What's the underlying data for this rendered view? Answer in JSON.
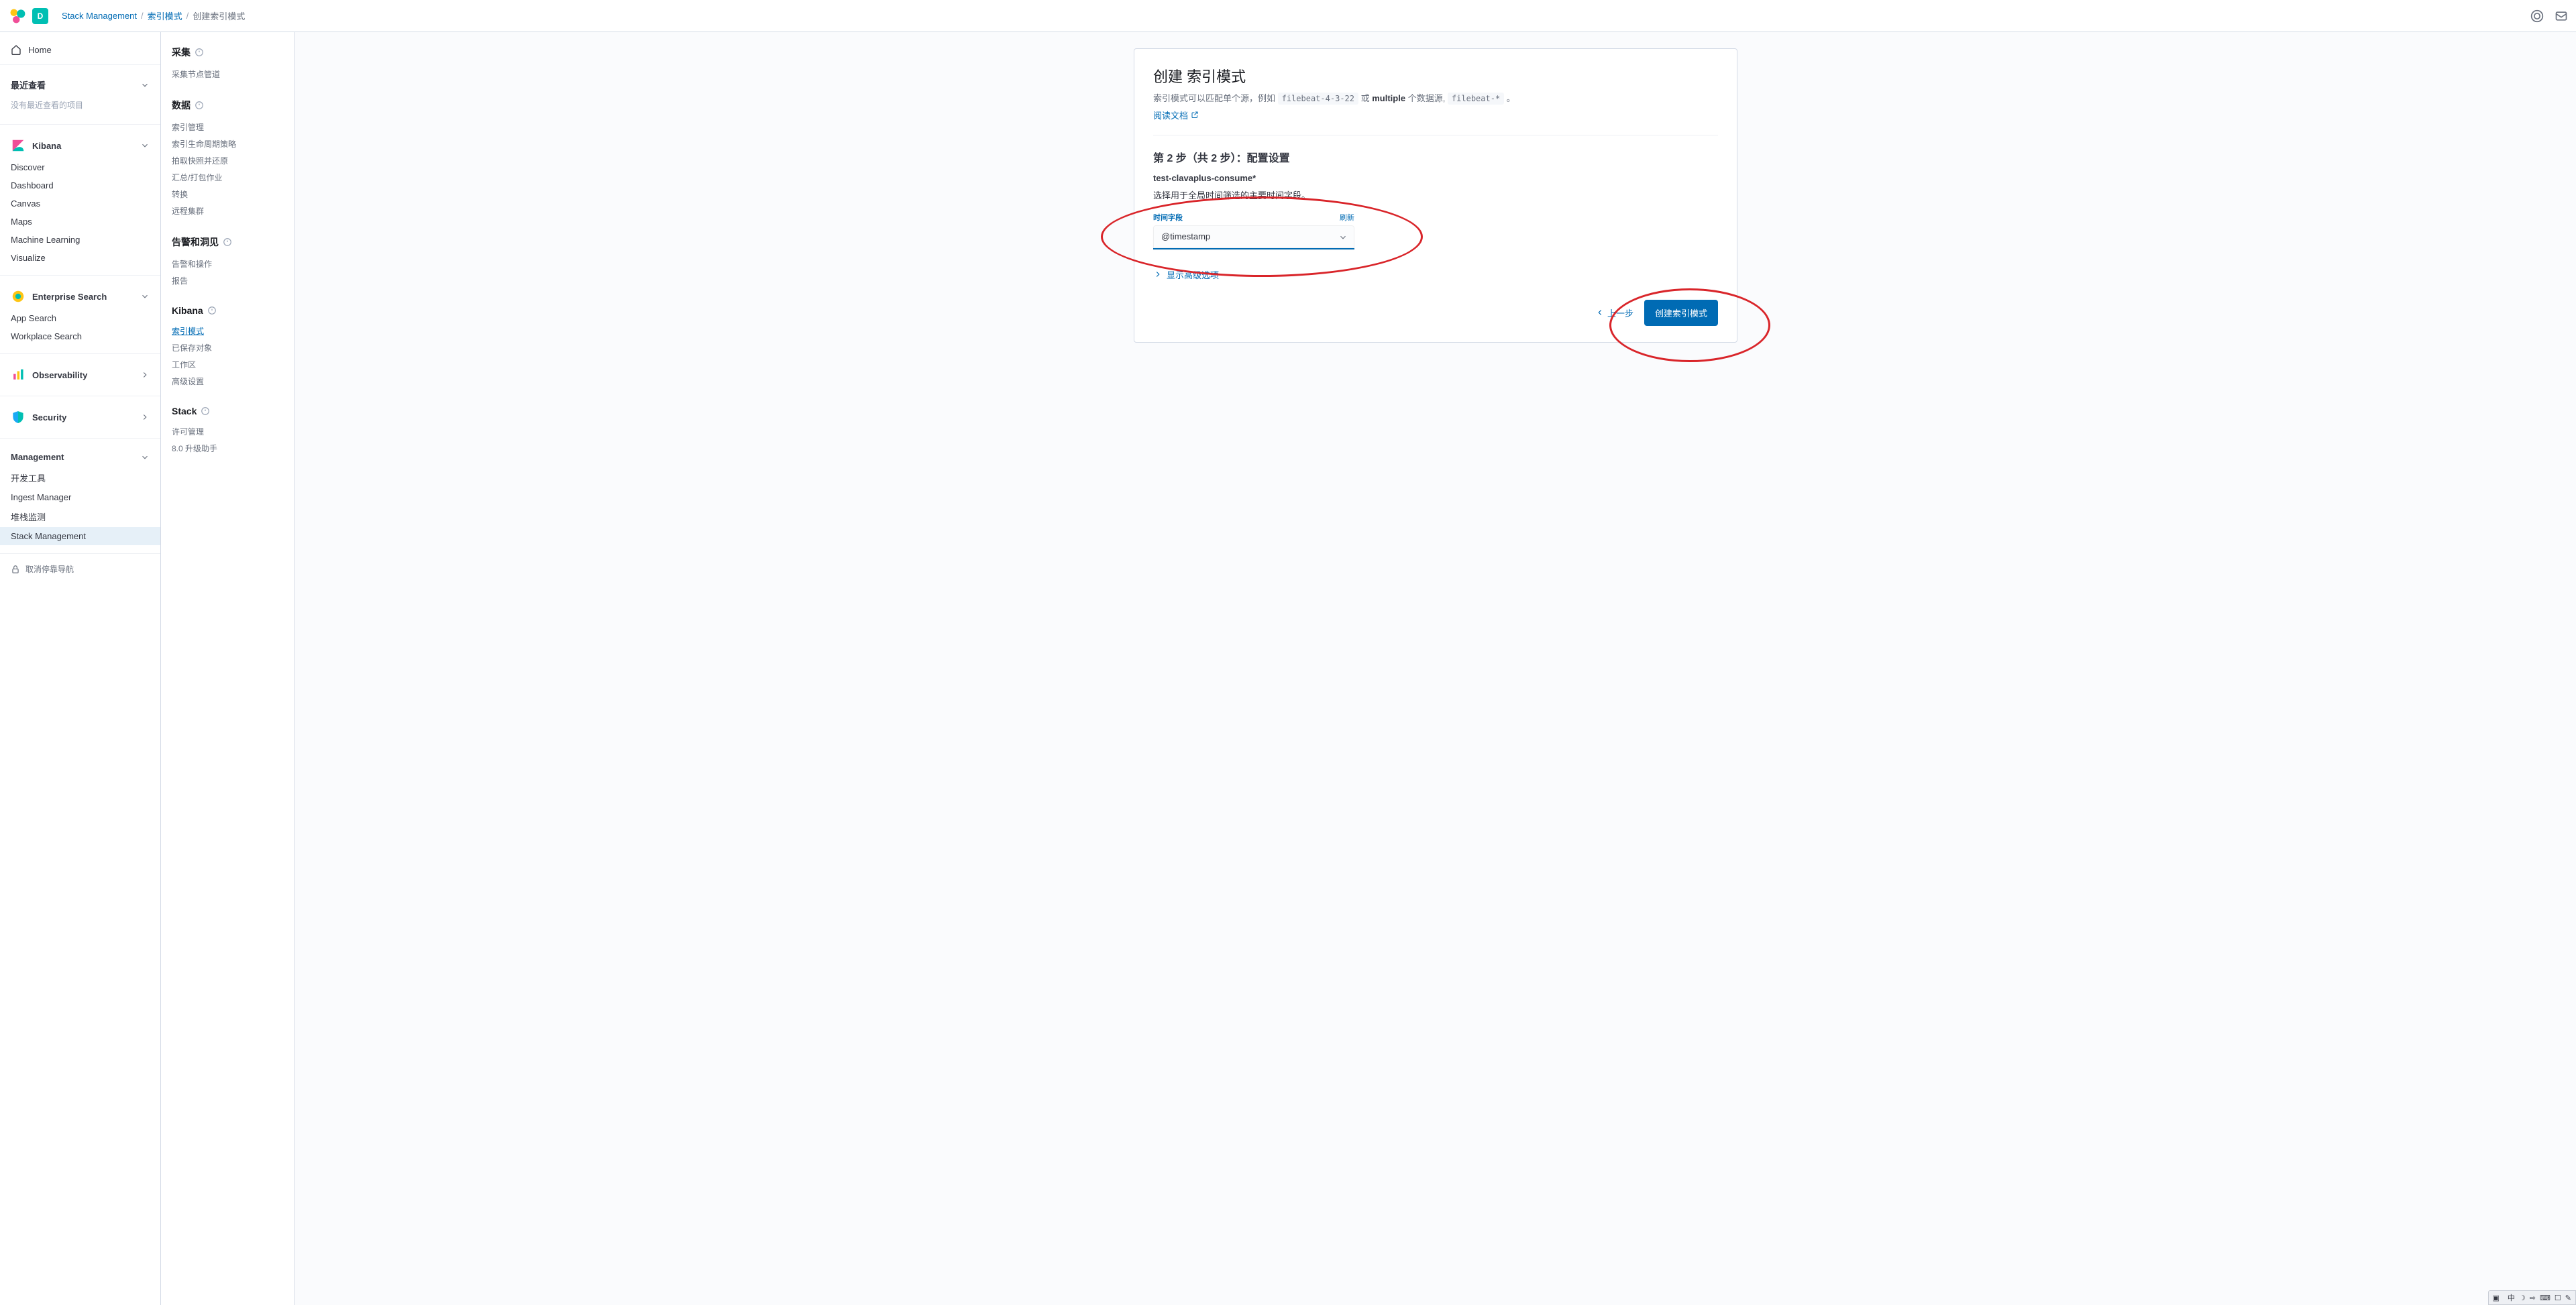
{
  "header": {
    "space_initial": "D",
    "breadcrumb": [
      "Stack Management",
      "索引模式",
      "创建索引模式"
    ]
  },
  "nav": {
    "home": "Home",
    "recent_title": "最近查看",
    "recent_empty": "没有最近查看的项目",
    "kibana_title": "Kibana",
    "kibana_items": [
      "Discover",
      "Dashboard",
      "Canvas",
      "Maps",
      "Machine Learning",
      "Visualize"
    ],
    "es_title": "Enterprise Search",
    "es_items": [
      "App Search",
      "Workplace Search"
    ],
    "obs_title": "Observability",
    "sec_title": "Security",
    "mgmt_title": "Management",
    "mgmt_items": [
      "开发工具",
      "Ingest Manager",
      "堆栈监测",
      "Stack Management"
    ],
    "mgmt_active_index": 3,
    "dock": "取消停靠导航"
  },
  "mgmt_nav": {
    "groups": [
      {
        "title": "采集",
        "items": [
          "采集节点管道"
        ]
      },
      {
        "title": "数据",
        "items": [
          "索引管理",
          "索引生命周期策略",
          "拍取快照并还原",
          "汇总/打包作业",
          "转换",
          "远程集群"
        ]
      },
      {
        "title": "告警和洞见",
        "items": [
          "告警和操作",
          "报告"
        ]
      },
      {
        "title": "Kibana",
        "items": [
          "索引模式",
          "已保存对象",
          "工作区",
          "高级设置"
        ],
        "active_index": 0
      },
      {
        "title": "Stack",
        "items": [
          "许可管理",
          "8.0 升级助手"
        ]
      }
    ]
  },
  "main": {
    "title": "创建 索引模式",
    "desc_pre": "索引模式可以匹配单个源，例如 ",
    "desc_code1": "filebeat-4-3-22",
    "desc_mid": " 或 ",
    "desc_bold": "multiple",
    "desc_post": " 个数据源, ",
    "desc_code2": "filebeat-*",
    "desc_end": " 。",
    "doc_link": "阅读文档",
    "step_title": "第 2 步（共 2 步）：配置设置",
    "pattern_name": "test-clavaplus-consume*",
    "help_text": "选择用于全局时间筛选的主要时间字段。",
    "time_field_label": "时间字段",
    "refresh_label": "刷新",
    "time_field_value": "@timestamp",
    "adv_toggle": "显示高级选项",
    "back_label": "上一步",
    "create_label": "创建索引模式"
  },
  "taskbar": {
    "items": [
      "中",
      "☽",
      "⇨",
      "⌨",
      "☐",
      "✎"
    ]
  }
}
